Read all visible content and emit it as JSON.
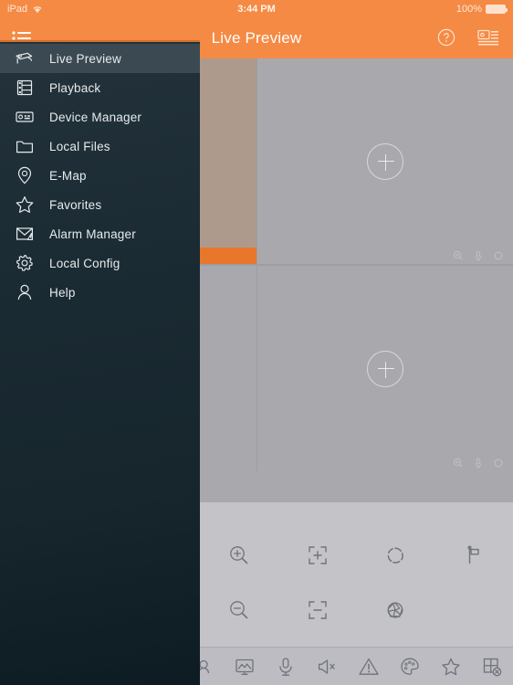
{
  "status_bar": {
    "device": "iPad",
    "wifi_icon": "wifi-icon",
    "time": "3:44 PM",
    "battery_percent": "100%",
    "battery_icon": "battery-full-icon"
  },
  "nav_bar": {
    "menu_icon": "list-menu-icon",
    "title": "Live Preview",
    "help_icon": "help-circle-icon",
    "device_list_icon": "device-list-icon"
  },
  "drawer": {
    "items": [
      {
        "label": "Live Preview",
        "icon": "camera-icon",
        "active": true
      },
      {
        "label": "Playback",
        "icon": "film-strip-icon",
        "active": false
      },
      {
        "label": "Device Manager",
        "icon": "device-icon",
        "active": false
      },
      {
        "label": "Local Files",
        "icon": "folder-icon",
        "active": false
      },
      {
        "label": "E-Map",
        "icon": "map-pin-icon",
        "active": false
      },
      {
        "label": "Favorites",
        "icon": "star-icon",
        "active": false
      },
      {
        "label": "Alarm Manager",
        "icon": "alarm-mail-icon",
        "active": false
      },
      {
        "label": "Local Config",
        "icon": "gear-icon",
        "active": false
      },
      {
        "label": "Help",
        "icon": "user-icon",
        "active": false
      }
    ]
  },
  "video_wall": {
    "add_icon": "plus-circle-icon",
    "cells": [
      {
        "name": "video-cell-1",
        "selected": true,
        "tinted": true,
        "has_add": false
      },
      {
        "name": "video-cell-2",
        "selected": false,
        "tinted": false,
        "has_add": true
      },
      {
        "name": "video-cell-3",
        "selected": false,
        "tinted": false,
        "has_add": false
      },
      {
        "name": "video-cell-4",
        "selected": false,
        "tinted": false,
        "has_add": true
      }
    ],
    "cell_toolbar_icons": [
      "digital-zoom-icon",
      "microphone-icon",
      "record-icon"
    ]
  },
  "ptz_panel": {
    "buttons": [
      {
        "name": "zoom-in-button",
        "icon": "magnifier-plus-icon"
      },
      {
        "name": "focus-near-button",
        "icon": "focus-plus-icon"
      },
      {
        "name": "iris-open-button",
        "icon": "iris-open-icon"
      },
      {
        "name": "preset-button",
        "icon": "flag-icon"
      },
      {
        "name": "zoom-out-button",
        "icon": "magnifier-minus-icon"
      },
      {
        "name": "focus-far-button",
        "icon": "focus-minus-icon"
      },
      {
        "name": "iris-close-button",
        "icon": "iris-close-icon"
      },
      {
        "name": "ptz-empty-slot",
        "icon": ""
      }
    ]
  },
  "bottom_bar": {
    "items": [
      {
        "name": "ptz-control-button",
        "icon": "ptz-joystick-icon"
      },
      {
        "name": "snapshot-button",
        "icon": "picture-icon"
      },
      {
        "name": "audio-talk-button",
        "icon": "microphone-icon"
      },
      {
        "name": "sound-off-button",
        "icon": "speaker-mute-icon"
      },
      {
        "name": "alarm-button",
        "icon": "warning-icon"
      },
      {
        "name": "image-color-button",
        "icon": "palette-icon"
      },
      {
        "name": "favorite-button",
        "icon": "star-icon"
      },
      {
        "name": "close-all-button",
        "icon": "grid-close-icon"
      }
    ]
  },
  "colors": {
    "accent_orange": "#F58A45",
    "cell_active_orange": "#E8762B",
    "drawer_dark": "#17262d",
    "panel_gray": "#c4c4c8",
    "video_gray": "#a9a9ad",
    "tint_tan": "#ae9a8c"
  }
}
